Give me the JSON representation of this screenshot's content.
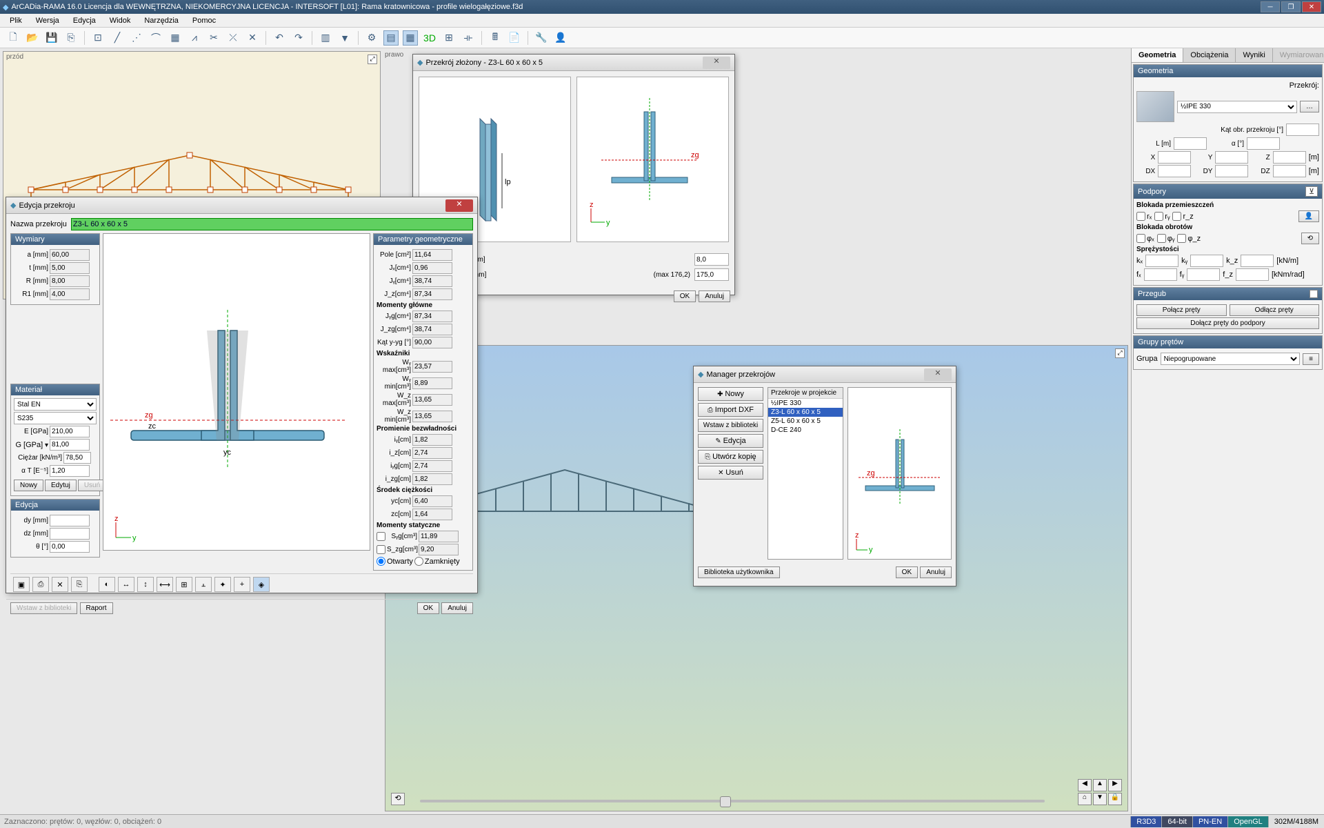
{
  "title": "ArCADia-RAMA 16.0 Licencja dla WEWNĘTRZNA, NIEKOMERCYJNA LICENCJA - INTERSOFT [L01]: Rama kratownicowa - profile wielogałęziowe.f3d",
  "menu": [
    "Plik",
    "Wersja",
    "Edycja",
    "Widok",
    "Narzędzia",
    "Pomoc"
  ],
  "vp": {
    "tl": "przód",
    "tr": "prawo"
  },
  "tabs": {
    "a": "Geometria",
    "b": "Obciążenia",
    "c": "Wyniki",
    "d": "Wymiarowanie"
  },
  "geom": {
    "hdr": "Geometria",
    "przekroj": "Przekrój:",
    "przekroj_val": "½IPE 330",
    "kat": "Kąt obr. przekroju [°]",
    "L": "L [m]",
    "alpha": "α [°]",
    "X": "X",
    "Y": "Y",
    "Z": "Z",
    "m": "[m]",
    "DX": "DX",
    "DY": "DY",
    "DZ": "DZ"
  },
  "podpory": {
    "hdr": "Podpory",
    "bp": "Blokada przemieszczeń",
    "bo": "Blokada obrotów",
    "sp": "Sprężystości",
    "rx": "rₓ",
    "ry": "rᵧ",
    "rz": "r_z",
    "fx": "φₓ",
    "fy": "φᵧ",
    "fz": "φ_z",
    "kx": "kₓ",
    "ky": "kᵧ",
    "kz": "k_z",
    "u1": "[kN/m]",
    "fx2": "fₓ",
    "fy2": "fᵧ",
    "fz2": "f_z",
    "u2": "[kNm/rad]"
  },
  "przegub": {
    "hdr": "Przegub",
    "b1": "Połącz pręty",
    "b2": "Odłącz pręty",
    "b3": "Dołącz pręty do podpory"
  },
  "grupy": {
    "hdr": "Grupy prętów",
    "lbl": "Grupa",
    "val": "Niepogrupowane"
  },
  "pz": {
    "title": "Przekrój złożony - Z3-L 60 x 60 x 5",
    "r1": "...ącej gałęzie lg [mm]",
    "v1": "8,0",
    "r2": "...ników gałęzi lp [mm]",
    "max": "(max 176,2)",
    "v2": "175,0",
    "ok": "OK",
    "cancel": "Anuluj"
  },
  "ep": {
    "title": "Edycja przekroju",
    "name_lbl": "Nazwa przekroju",
    "name_val": "Z3-L 60 x 60 x 5",
    "wym": "Wymiary",
    "a": "a [mm]",
    "av": "60,00",
    "t": "t [mm]",
    "tv": "5,00",
    "R": "R [mm]",
    "Rv": "8,00",
    "R1": "R1 [mm]",
    "R1v": "4,00",
    "mat": "Materiał",
    "mat1": "Stal EN",
    "mat2": "S235",
    "E": "E [GPa]",
    "Ev": "210,00",
    "G": "G [GPa]",
    "Gv": "81,00",
    "Ciezar": "Ciężar [kN/m³]",
    "Cv": "78,50",
    "aT": "α T [E⁻⁵]",
    "aTv": "1,20",
    "nowy": "Nowy",
    "edytuj": "Edytuj",
    "usun": "Usuń",
    "edycja": "Edycja",
    "dy": "dy [mm]",
    "dz": "dz [mm]",
    "theta": "θ [°]",
    "thetav": "0,00",
    "params_h": "Parametry geometryczne",
    "pole": "Pole [cm²]",
    "polev": "11,64",
    "Jx": "Jₓ[cm⁴]",
    "Jxv": "0,96",
    "Jy": "Jᵧ[cm⁴]",
    "Jyv": "38,74",
    "Jz": "J_z[cm⁴]",
    "Jzv": "87,34",
    "mg": "Momenty główne",
    "Jyg": "Jᵧg[cm⁴]",
    "Jygv": "87,34",
    "Jzg": "J_zg[cm⁴]",
    "Jzgv": "38,74",
    "kat": "Kąt y-yg [°]",
    "katv": "90,00",
    "wsk": "Wskaźniki",
    "Wymax": "Wᵧ max[cm³]",
    "Wymaxv": "23,57",
    "Wymin": "Wᵧ min[cm³]",
    "Wyminv": "8,89",
    "Wzmax": "W_z max[cm³]",
    "Wzmaxv": "13,65",
    "Wzmin": "W_z min[cm³]",
    "Wzminv": "13,65",
    "pb": "Promienie bezwładności",
    "iy": "iᵧ[cm]",
    "iyv": "1,82",
    "iz": "i_z[cm]",
    "izv": "2,74",
    "iyg": "iᵧg[cm]",
    "iygv": "2,74",
    "izg": "i_zg[cm]",
    "izgv": "1,82",
    "sc": "Środek ciężkości",
    "yc": "yc[cm]",
    "ycv": "6,40",
    "zc": "zc[cm]",
    "zcv": "1,64",
    "ms": "Momenty statyczne",
    "Syg": "Sᵧg[cm³]",
    "Sygv": "11,89",
    "Szg": "S_zg[cm³]",
    "Szgv": "9,20",
    "otwarty": "Otwarty",
    "zamkniety": "Zamknięty",
    "wstawzb": "Wstaw z biblioteki",
    "raport": "Raport",
    "ok": "OK",
    "anuluj": "Anuluj"
  },
  "mp": {
    "title": "Manager przekrojów",
    "nowy": "Nowy",
    "import": "Import DXF",
    "wstaw": "Wstaw z biblioteki",
    "edycja": "Edycja",
    "kopia": "Utwórz kopię",
    "usun": "Usuń",
    "listh": "Przekroje w projekcie",
    "items": [
      "½IPE 330",
      "Z3-L 60 x 60 x 5",
      "Z5-L 60 x 60 x 5",
      "D-CE 240"
    ],
    "bib": "Biblioteka użytkownika",
    "ok": "OK",
    "anuluj": "Anuluj"
  },
  "status": {
    "left": "Zaznaczono: prętów: 0, węzłów: 0, obciążeń: 0",
    "r3d3": "R3D3",
    "bit": "64-bit",
    "pnen": "PN-EN",
    "ogl": "OpenGL",
    "mem": "302M/4188M"
  }
}
